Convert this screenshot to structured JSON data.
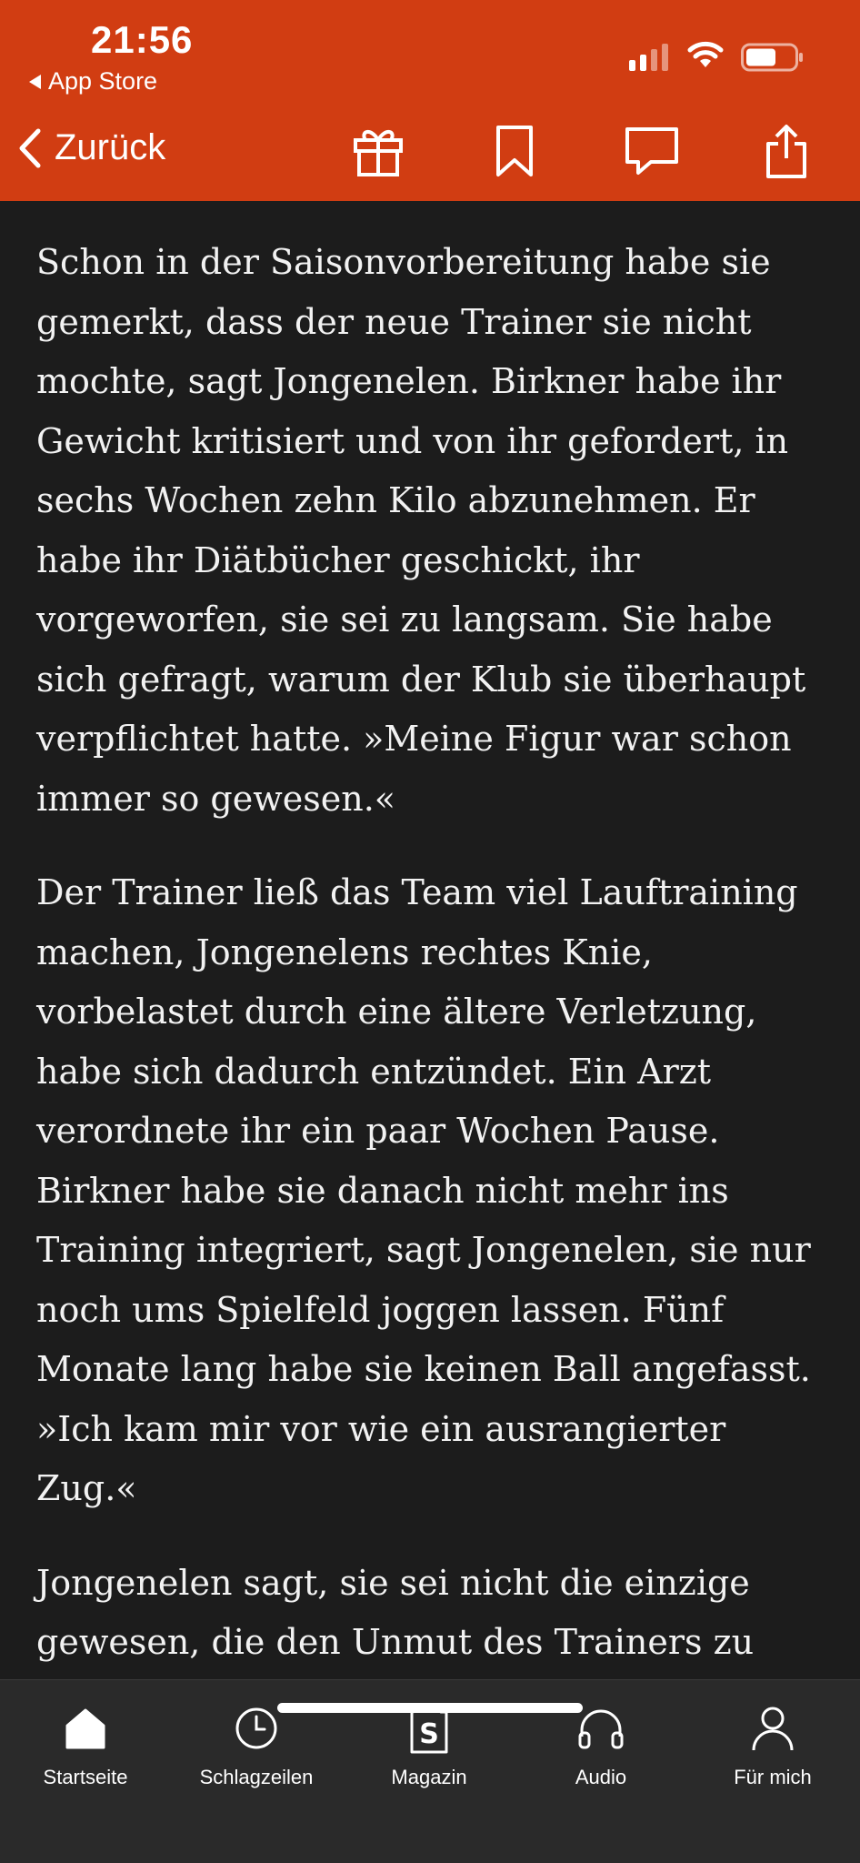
{
  "status_bar": {
    "time": "21:56",
    "back_app": "App Store",
    "icons": [
      "signal-icon",
      "wifi-icon",
      "battery-icon"
    ]
  },
  "nav": {
    "back_label": "Zurück",
    "actions": [
      "gift-icon",
      "bookmark-icon",
      "comment-icon",
      "share-icon"
    ]
  },
  "article": {
    "paragraphs": [
      "Schon in der Saisonvorbereitung habe sie gemerkt, dass der neue Trainer sie nicht mochte, sagt Jongenelen. Birkner habe ihr Gewicht kritisiert und von ihr gefordert, in sechs Wochen zehn Kilo abzunehmen. Er habe ihr Diätbücher geschickt, ihr vorgeworfen, sie sei zu langsam. Sie habe sich gefragt, warum der Klub sie überhaupt verpflichtet hatte. »Meine Figur war schon immer so gewesen.«",
      "Der Trainer ließ das Team viel Lauftraining machen, Jongenelens rechtes Knie, vorbelastet durch eine ältere Verletzung, habe sich dadurch entzündet. Ein Arzt verordnete ihr ein paar Wochen Pause. Birkner habe sie danach nicht mehr ins Training integriert, sagt Jongenelen, sie nur noch ums Spielfeld joggen lassen. Fünf Monate lang habe sie keinen Ball angefasst. »Ich kam mir vor wie ein ausrangierter Zug.«",
      "Jongenelen sagt, sie sei nicht die einzige gewesen, die den Unmut des Trainers zu spüren bekommen habe. »Wenn wir Fehler"
    ]
  },
  "tabbar": {
    "tabs": [
      {
        "label": "Startseite",
        "icon": "home-icon"
      },
      {
        "label": "Schlagzeilen",
        "icon": "clock-icon"
      },
      {
        "label": "Magazin",
        "icon": "magazine-icon"
      },
      {
        "label": "Audio",
        "icon": "headphones-icon"
      },
      {
        "label": "Für mich",
        "icon": "person-icon"
      }
    ]
  },
  "colors": {
    "header": "#d13d12",
    "background": "#1c1c1c",
    "tabbar": "#2a2a2a"
  }
}
